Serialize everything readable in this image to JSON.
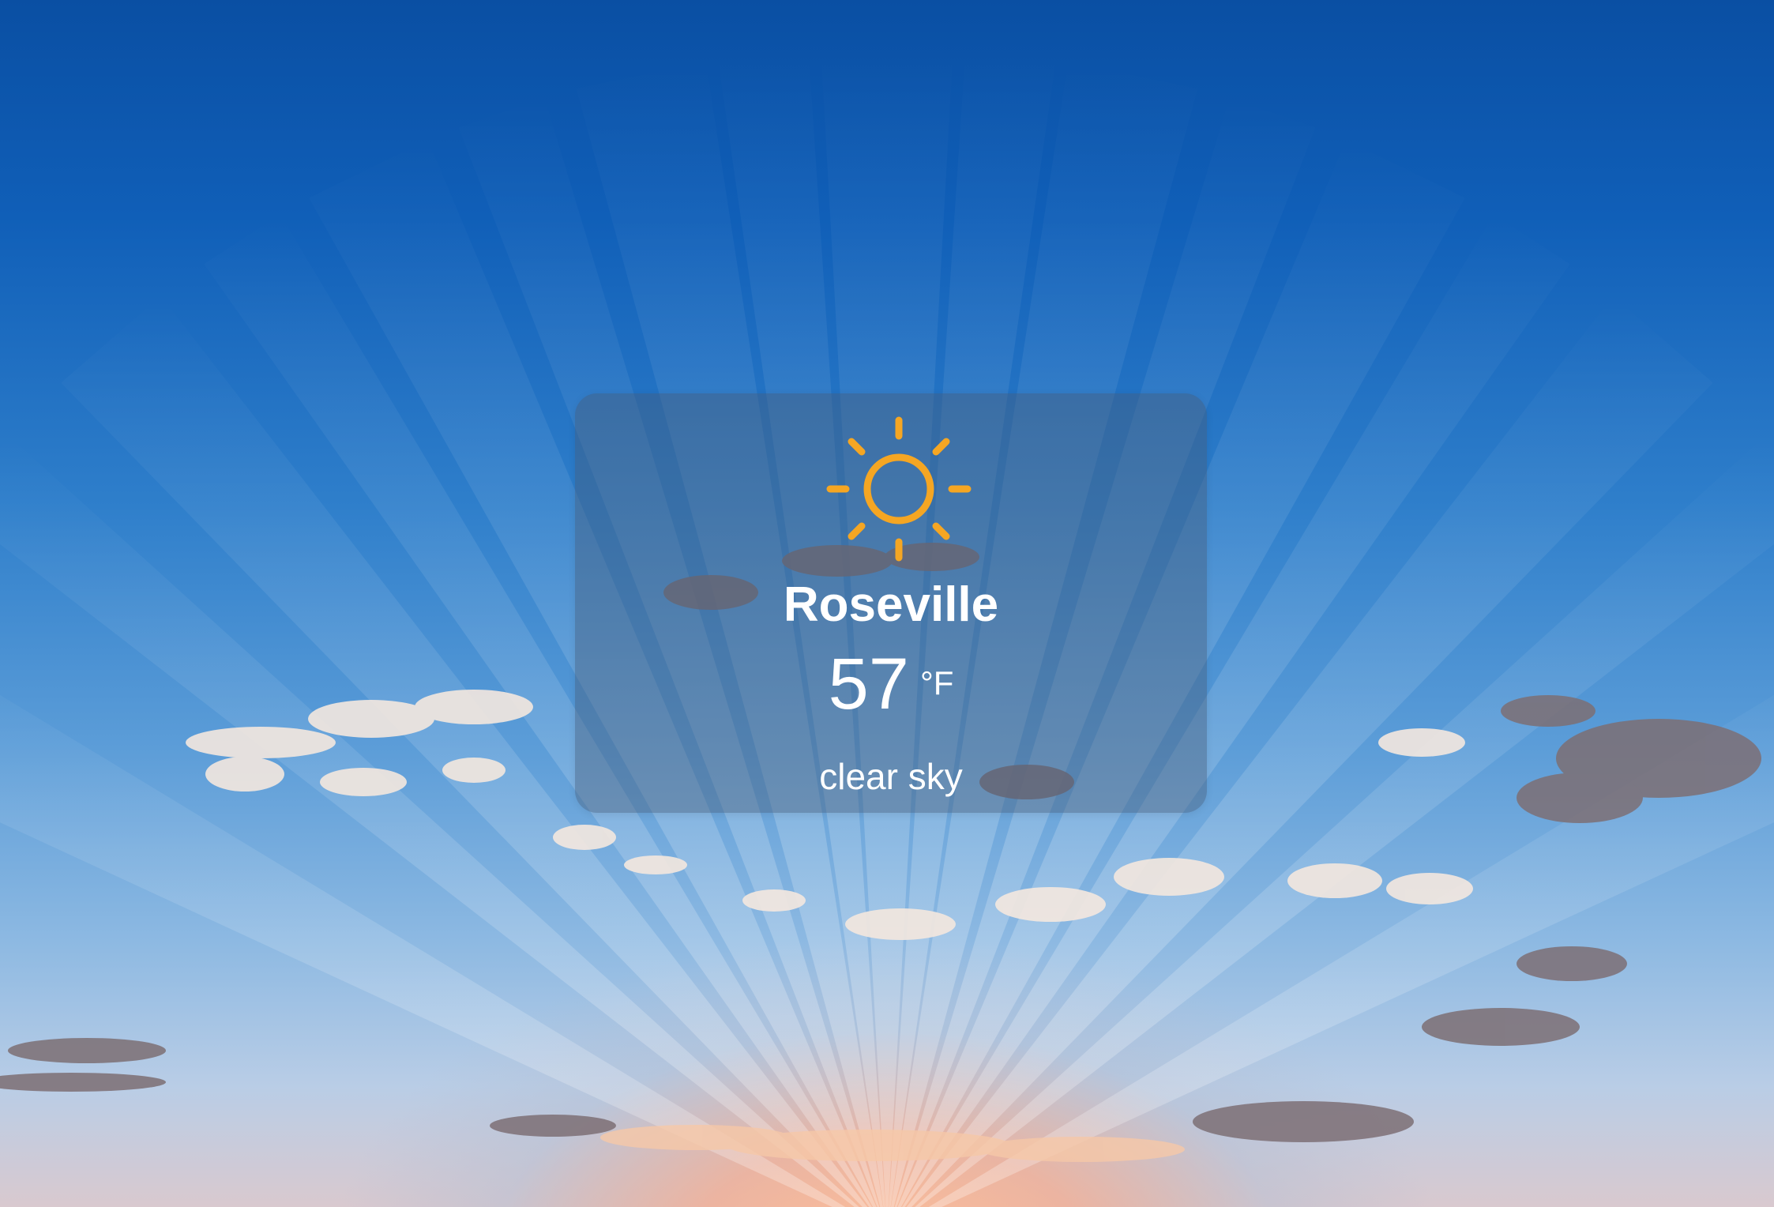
{
  "weather": {
    "city": "Roseville",
    "temperature": "57",
    "unit": "°F",
    "description": "clear sky",
    "icon": "sun-icon"
  },
  "colors": {
    "sun": "#f5a623",
    "text": "#ffffff",
    "card_background": "rgba(70, 90, 120, 0.42)",
    "sky_top": "#0a4fa3",
    "horizon_glow": "#f3ad91"
  }
}
